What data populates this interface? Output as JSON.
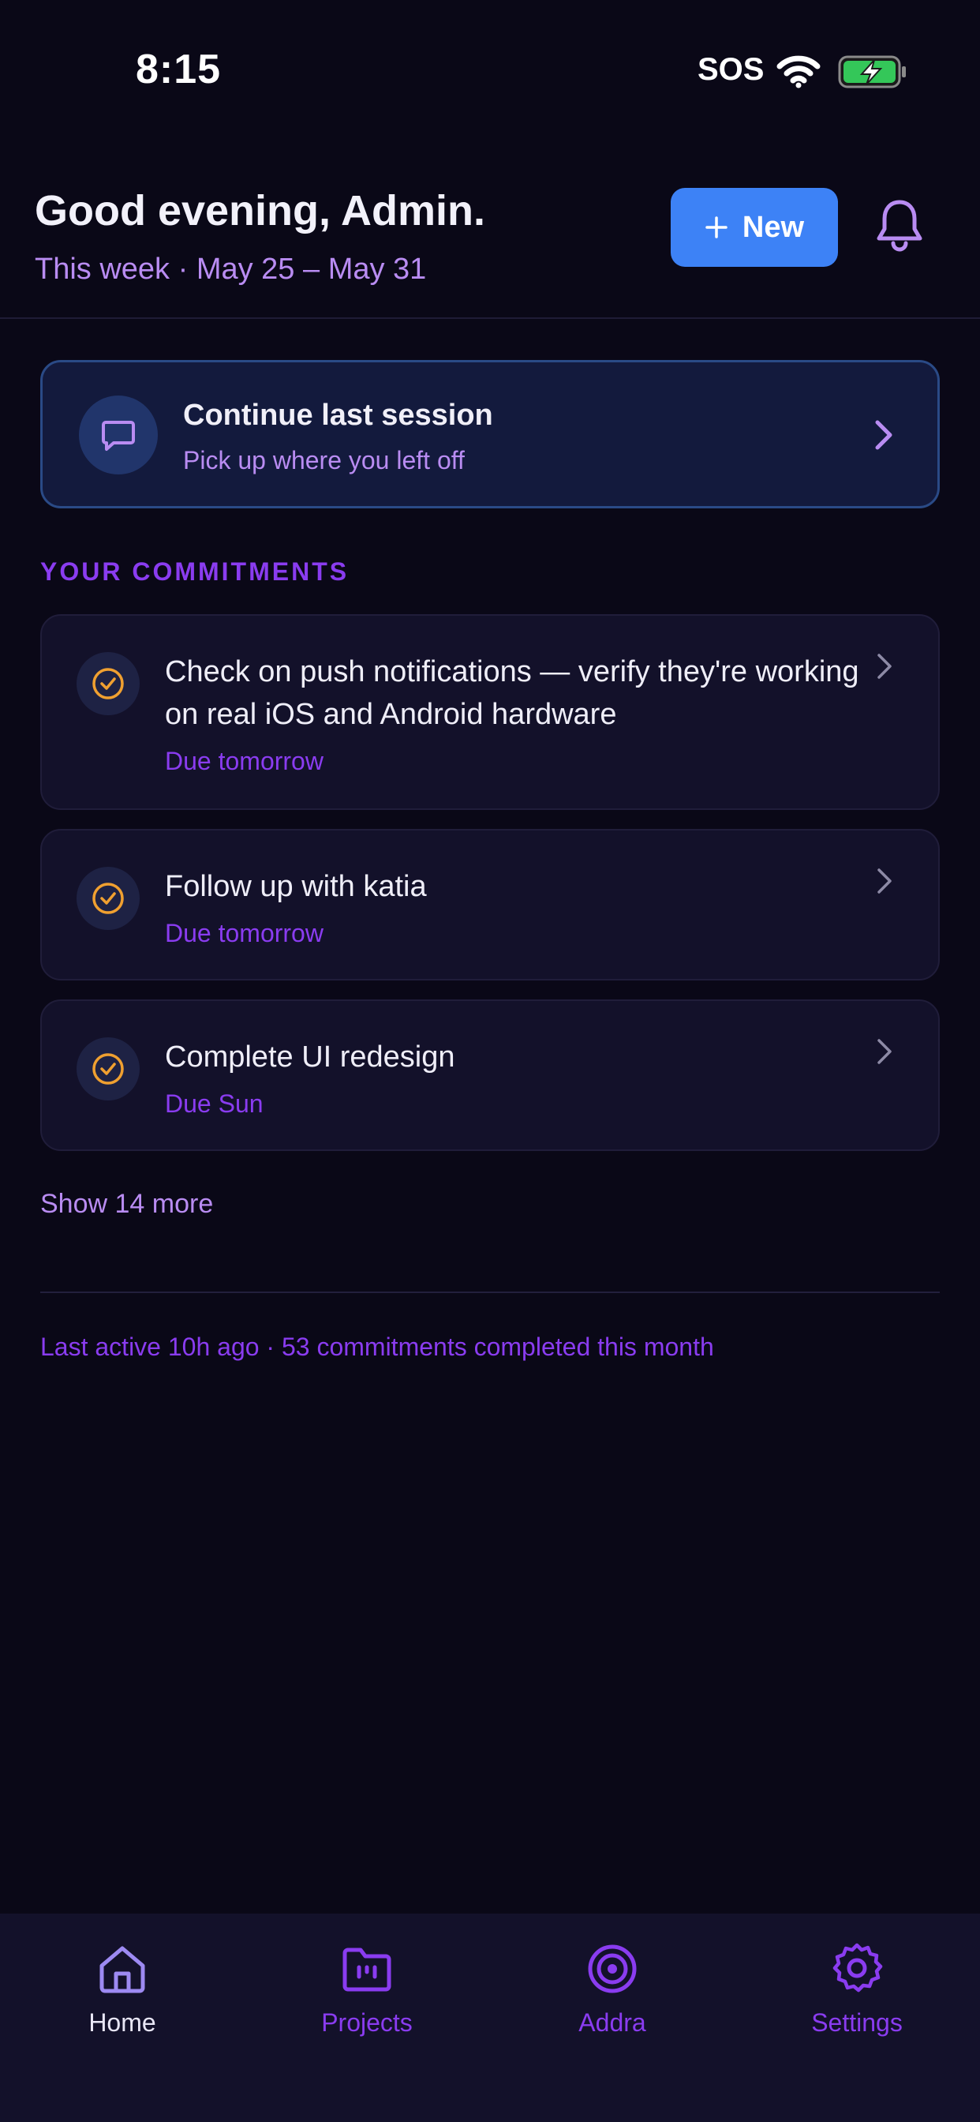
{
  "status_bar": {
    "time": "8:15",
    "carrier": "SOS",
    "icons": [
      "wifi-icon",
      "battery-charging-icon"
    ]
  },
  "header": {
    "greeting": "Good evening, Admin.",
    "week_range": "This week · May 25 – May 31",
    "new_button_label": "New",
    "icons": [
      "plus-icon",
      "bell-icon"
    ]
  },
  "session_card": {
    "title": "Continue last session",
    "subtitle": "Pick up where you left off",
    "icons": [
      "chat-bubble-icon",
      "chevron-right-icon"
    ]
  },
  "commitments": {
    "heading": "YOUR COMMITMENTS",
    "items": [
      {
        "title": "Check on push notifications — verify they're working on real iOS and Android hardware",
        "due": "Due tomorrow"
      },
      {
        "title": "Follow up with katia",
        "due": "Due tomorrow"
      },
      {
        "title": "Complete UI redesign",
        "due": "Due Sun"
      }
    ],
    "show_more": "Show 14 more"
  },
  "footer": {
    "stats": "Last active 10h ago · 53 commitments completed this month"
  },
  "tab_bar": {
    "active": "Home",
    "tabs": [
      {
        "label": "Home",
        "icon": "home-icon"
      },
      {
        "label": "Projects",
        "icon": "folder-icon"
      },
      {
        "label": "Addra",
        "icon": "target-icon"
      },
      {
        "label": "Settings",
        "icon": "gear-icon"
      }
    ]
  },
  "colors": {
    "background": "#0a0817",
    "accent_blue": "#3d82f6",
    "accent_purple": "#8a3cf0",
    "light_purple": "#b98cf2",
    "check_orange": "#f0a030",
    "tab_bar_bg": "#13112a"
  }
}
